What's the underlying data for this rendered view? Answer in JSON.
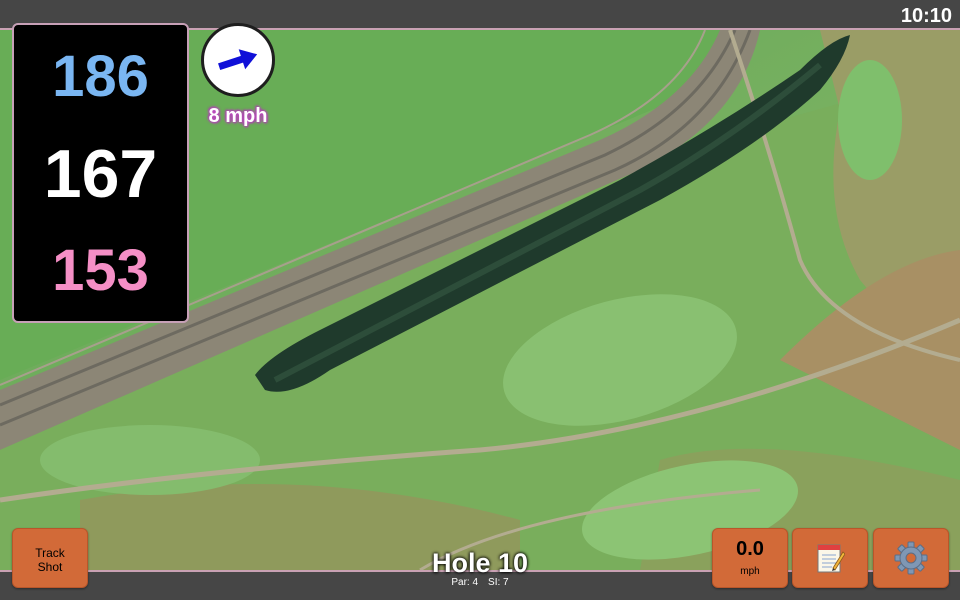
{
  "status_bar": {
    "time": "10:10"
  },
  "distances": {
    "back": "186",
    "middle": "167",
    "front": "153"
  },
  "wind": {
    "speed_label": "8 mph",
    "direction_icon": "arrow-up-right"
  },
  "track_shot": {
    "line1": "Track",
    "line2": "Shot"
  },
  "speed": {
    "value": "0.0",
    "unit": "mph"
  },
  "notes": {
    "icon": "notepad-icon"
  },
  "settings": {
    "icon": "gear-icon"
  },
  "hole": {
    "title": "Hole 10",
    "par": "Par: 4",
    "si": "SI: 7"
  },
  "colors": {
    "back_distance": "#7ab6f2",
    "middle_distance": "#ffffff",
    "front_distance": "#f58fc6",
    "button": "#d26a38",
    "bar": "#464646"
  }
}
